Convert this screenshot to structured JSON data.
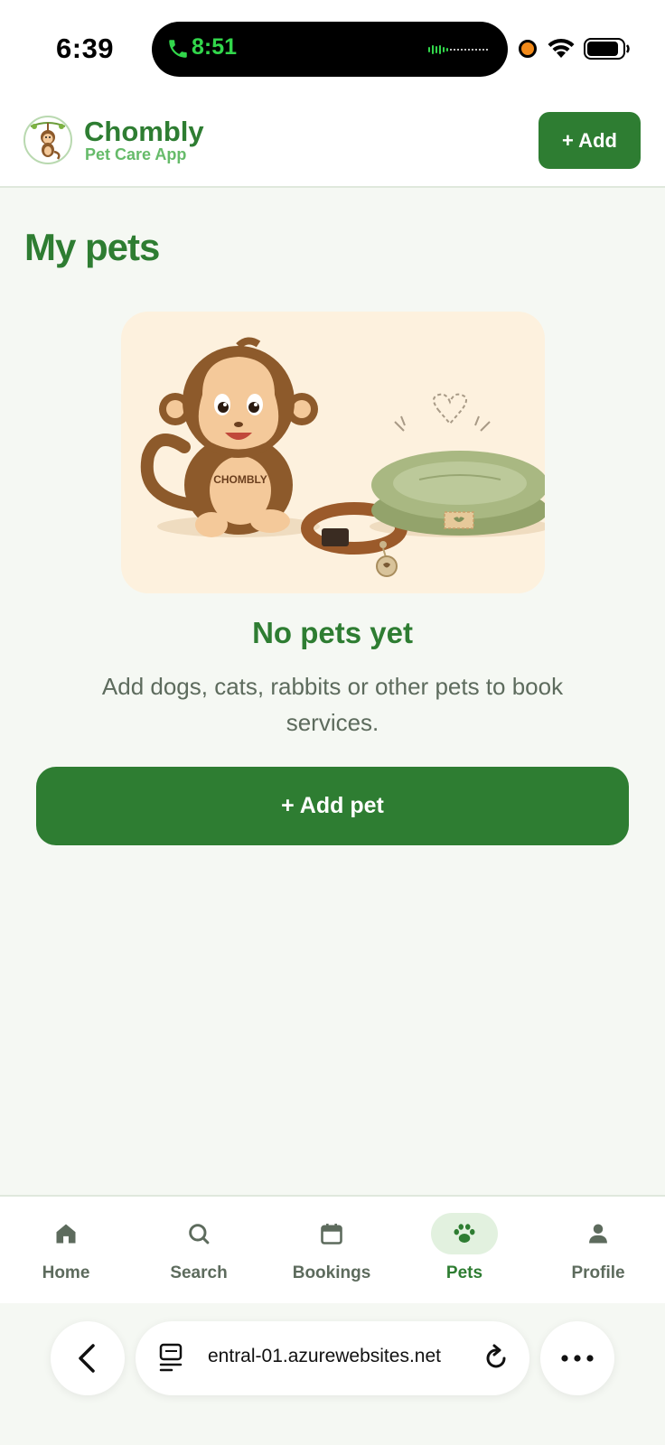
{
  "status_bar": {
    "time": "6:39",
    "call_timer": "8:51",
    "icons": [
      "phone-icon",
      "audio-wave-icon",
      "recording-dot-icon",
      "wifi-icon",
      "battery-icon"
    ]
  },
  "header": {
    "brand_name": "Chombly",
    "brand_subtitle": "Pet Care App",
    "add_label": "+ Add"
  },
  "main": {
    "title": "My pets",
    "empty_title": "No pets yet",
    "empty_description": "Add dogs, cats, rabbits or other pets to book services.",
    "add_pet_label": "+ Add pet",
    "illustration_text": "CHOMBLY"
  },
  "bottom_nav": {
    "items": [
      {
        "label": "Home",
        "icon": "home-icon",
        "active": false
      },
      {
        "label": "Search",
        "icon": "search-icon",
        "active": false
      },
      {
        "label": "Bookings",
        "icon": "calendar-icon",
        "active": false
      },
      {
        "label": "Pets",
        "icon": "paw-icon",
        "active": true
      },
      {
        "label": "Profile",
        "icon": "person-icon",
        "active": false
      }
    ]
  },
  "browser": {
    "url": "entral-01.azurewebsites.net"
  },
  "colors": {
    "primary": "#2e7d32",
    "primary_light": "#66bb6a",
    "background": "#f5f8f3",
    "active_nav_bg": "#e2f1df",
    "muted_text": "#5d6b5d"
  }
}
